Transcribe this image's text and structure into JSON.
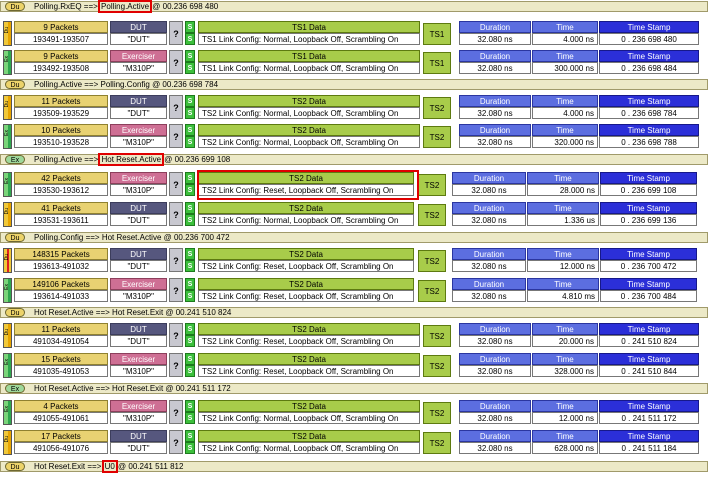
{
  "col_labels": {
    "dut": "DUT",
    "exerciser": "Exerciser",
    "duration": "Duration",
    "time": "Time",
    "timestamp": "Time Stamp",
    "question": "?",
    "s": "S"
  },
  "states": [
    {
      "tag": "Du",
      "prefix": "Polling.RxEQ ==> ",
      "target": "Polling.Active",
      "suffix": " @ 00.236 698 480",
      "highlight": true
    },
    {
      "tag": "Du",
      "prefix": "Polling.Active ==> Polling.Config @ 00.236 698 784",
      "target": "",
      "suffix": "",
      "highlight": false
    },
    {
      "tag": "Ex",
      "prefix": "Polling.Active ==> ",
      "target": "Hot Reset.Active",
      "suffix": " @ 00.236 699 108",
      "highlight": true
    },
    {
      "tag": "Du",
      "prefix": "Polling.Config ==> Hot Reset.Active @ 00.236 700 472",
      "target": "",
      "suffix": "",
      "highlight": false
    },
    {
      "tag": "Du",
      "prefix": "Hot Reset.Active ==> Hot Reset.Exit @ 00.241 510 824",
      "target": "",
      "suffix": "",
      "highlight": false
    },
    {
      "tag": "Ex",
      "prefix": "Hot Reset.Active ==> Hot Reset.Exit @ 00.241 511 172",
      "target": "",
      "suffix": "",
      "highlight": false
    },
    {
      "tag": "Du",
      "prefix": "Hot Reset.Exit ==> ",
      "target": "U0",
      "suffix": " @ 00.241 511 812",
      "highlight": true
    }
  ],
  "packets": [
    {
      "strip": "Du",
      "packets": "9 Packets",
      "range": "193491-193507",
      "src": "DUT",
      "src_val": "\"DUT\"",
      "ts_title": "TS1 Data",
      "ts_val": "TS1 Link Config: Normal, Loopback Off, Scrambling On",
      "ts_type": "TS1",
      "duration": "32.080 ns",
      "time": "4.000 ns",
      "stamp": "0 . 236 698 480"
    },
    {
      "strip": "Ex",
      "packets": "9 Packets",
      "range": "193492-193508",
      "src": "Exerciser",
      "src_val": "\"M310P\"",
      "ts_title": "TS1 Data",
      "ts_val": "TS1 Link Config: Normal, Loopback Off, Scrambling On",
      "ts_type": "TS1",
      "duration": "32.080 ns",
      "time": "300.000 ns",
      "stamp": "0 . 236 698 484"
    },
    {
      "strip": "Du",
      "packets": "11 Packets",
      "range": "193509-193529",
      "src": "DUT",
      "src_val": "\"DUT\"",
      "ts_title": "TS2 Data",
      "ts_val": "TS2 Link Config: Normal, Loopback Off, Scrambling On",
      "ts_type": "TS2",
      "duration": "32.080 ns",
      "time": "4.000 ns",
      "stamp": "0 . 236 698 784"
    },
    {
      "strip": "Ex",
      "packets": "10 Packets",
      "range": "193510-193528",
      "src": "Exerciser",
      "src_val": "\"M310P\"",
      "ts_title": "TS2 Data",
      "ts_val": "TS2 Link Config: Normal, Loopback Off, Scrambling On",
      "ts_type": "TS2",
      "duration": "32.080 ns",
      "time": "320.000 ns",
      "stamp": "0 . 236 698 788"
    },
    {
      "strip": "Ex",
      "packets": "42 Packets",
      "range": "193530-193612",
      "src": "Exerciser",
      "src_val": "\"M310P\"",
      "ts_title": "TS2 Data",
      "ts_val": "TS2 Link Config: Reset, Loopback Off, Scrambling On",
      "ts_type": "TS2",
      "duration": "32.080 ns",
      "time": "28.000 ns",
      "stamp": "0 . 236 699 108"
    },
    {
      "strip": "Du",
      "packets": "41 Packets",
      "range": "193531-193611",
      "src": "DUT",
      "src_val": "\"DUT\"",
      "ts_title": "TS2 Data",
      "ts_val": "TS2 Link Config: Normal, Loopback Off, Scrambling On",
      "ts_type": "TS2",
      "duration": "32.080 ns",
      "time": "1.336 us",
      "stamp": "0 . 236 699 136"
    },
    {
      "strip": "Red",
      "packets": "148315 Packets",
      "range": "193613-491032",
      "src": "DUT",
      "src_val": "\"DUT\"",
      "ts_title": "TS2 Data",
      "ts_val": "TS2 Link Config: Reset, Loopback Off, Scrambling On",
      "ts_type": "TS2",
      "duration": "32.080 ns",
      "time": "12.000 ns",
      "stamp": "0 . 236 700 472"
    },
    {
      "strip": "Ex",
      "packets": "149106 Packets",
      "range": "193614-491033",
      "src": "Exerciser",
      "src_val": "\"M310P\"",
      "ts_title": "TS2 Data",
      "ts_val": "TS2 Link Config: Reset, Loopback Off, Scrambling On",
      "ts_type": "TS2",
      "duration": "32.080 ns",
      "time": "4.810 ms",
      "stamp": "0 . 236 700 484"
    },
    {
      "strip": "Du",
      "packets": "11 Packets",
      "range": "491034-491054",
      "src": "DUT",
      "src_val": "\"DUT\"",
      "ts_title": "TS2 Data",
      "ts_val": "TS2 Link Config: Reset, Loopback Off, Scrambling On",
      "ts_type": "TS2",
      "duration": "32.080 ns",
      "time": "20.000 ns",
      "stamp": "0 . 241 510 824"
    },
    {
      "strip": "Ex",
      "packets": "15 Packets",
      "range": "491035-491053",
      "src": "Exerciser",
      "src_val": "\"M310P\"",
      "ts_title": "TS2 Data",
      "ts_val": "TS2 Link Config: Reset, Loopback Off, Scrambling On",
      "ts_type": "TS2",
      "duration": "32.080 ns",
      "time": "328.000 ns",
      "stamp": "0 . 241 510 844"
    },
    {
      "strip": "Ex",
      "packets": "4 Packets",
      "range": "491055-491061",
      "src": "Exerciser",
      "src_val": "\"M310P\"",
      "ts_title": "TS2 Data",
      "ts_val": "TS2 Link Config: Normal, Loopback Off, Scrambling On",
      "ts_type": "TS2",
      "duration": "32.080 ns",
      "time": "12.000 ns",
      "stamp": "0 . 241 511 172"
    },
    {
      "strip": "Du",
      "packets": "17 Packets",
      "range": "491056-491076",
      "src": "DUT",
      "src_val": "\"DUT\"",
      "ts_title": "TS2 Data",
      "ts_val": "TS2 Link Config: Normal, Loopback Off, Scrambling On",
      "ts_type": "TS2",
      "duration": "32.080 ns",
      "time": "628.000 ns",
      "stamp": "0 . 241 511 184"
    }
  ]
}
